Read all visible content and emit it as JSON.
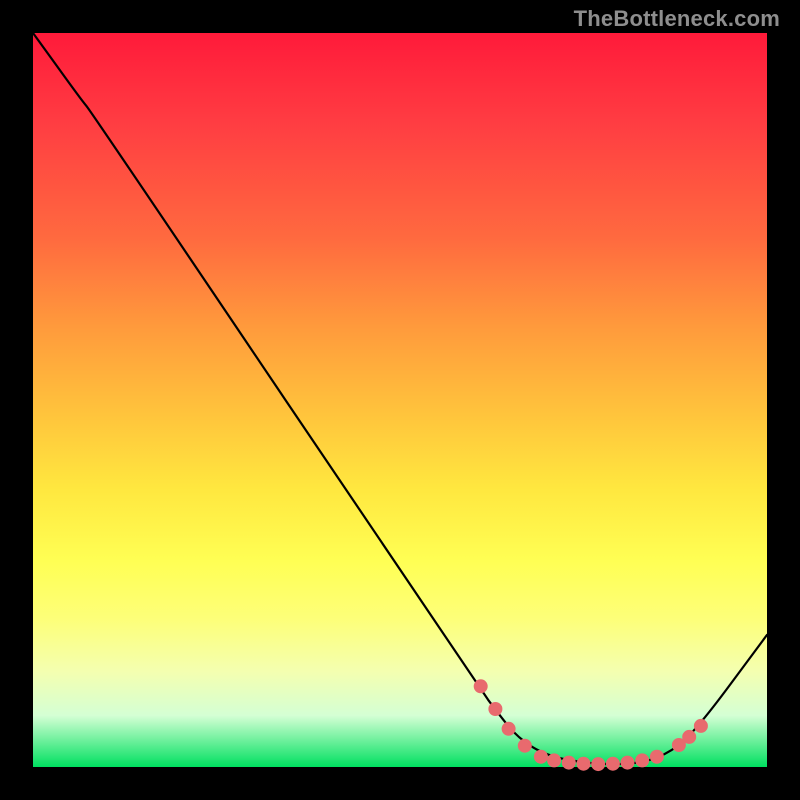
{
  "attribution": "TheBottleneck.com",
  "colors": {
    "line": "#000000",
    "marker_fill": "#e86a6e",
    "marker_stroke": "#e86a6e"
  },
  "chart_data": {
    "type": "line",
    "title": "",
    "xlabel": "",
    "ylabel": "",
    "xlim": [
      0,
      100
    ],
    "ylim": [
      0,
      100
    ],
    "note": "Values read off pixel positions inside the 734x734 plot area; y=0 at bottom, y=100 at top.",
    "curve": [
      {
        "x": 0.0,
        "y": 100.0
      },
      {
        "x": 6.5,
        "y": 91.0
      },
      {
        "x": 8.0,
        "y": 89.2
      },
      {
        "x": 61.0,
        "y": 10.5
      },
      {
        "x": 63.0,
        "y": 7.8
      },
      {
        "x": 66.0,
        "y": 4.0
      },
      {
        "x": 70.0,
        "y": 1.5
      },
      {
        "x": 76.0,
        "y": 0.4
      },
      {
        "x": 82.0,
        "y": 0.4
      },
      {
        "x": 86.0,
        "y": 1.5
      },
      {
        "x": 90.0,
        "y": 4.5
      },
      {
        "x": 100.0,
        "y": 18.0
      }
    ],
    "markers": [
      {
        "x": 61.0,
        "y": 11.0
      },
      {
        "x": 63.0,
        "y": 7.9
      },
      {
        "x": 64.8,
        "y": 5.2
      },
      {
        "x": 67.0,
        "y": 2.9
      },
      {
        "x": 69.2,
        "y": 1.4
      },
      {
        "x": 71.0,
        "y": 0.9
      },
      {
        "x": 73.0,
        "y": 0.6
      },
      {
        "x": 75.0,
        "y": 0.45
      },
      {
        "x": 77.0,
        "y": 0.4
      },
      {
        "x": 79.0,
        "y": 0.45
      },
      {
        "x": 81.0,
        "y": 0.6
      },
      {
        "x": 83.0,
        "y": 0.9
      },
      {
        "x": 85.0,
        "y": 1.4
      },
      {
        "x": 88.0,
        "y": 3.0
      },
      {
        "x": 89.4,
        "y": 4.1
      },
      {
        "x": 91.0,
        "y": 5.6
      }
    ]
  }
}
